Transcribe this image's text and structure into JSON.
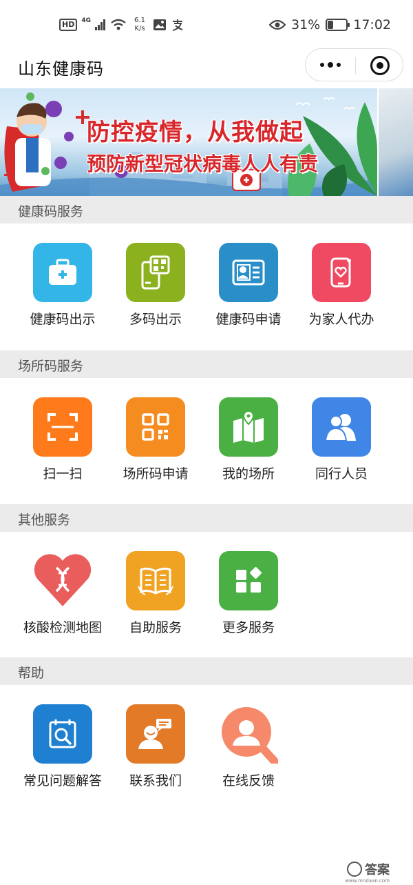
{
  "status_bar": {
    "hd": "HD",
    "network": "4G",
    "speed_value": "6.1",
    "speed_unit": "K/s",
    "battery_percent": "31%",
    "battery_level": 0.31,
    "time": "17:02"
  },
  "nav": {
    "title": "山东健康码"
  },
  "banner": {
    "line1": "防控疫情，从我做起",
    "line2": "预防新型冠状病毒人人有责"
  },
  "sections": [
    {
      "title": "健康码服务",
      "items": [
        {
          "label": "健康码出示",
          "icon": "medical-kit-icon",
          "color": "#33b5e8"
        },
        {
          "label": "多码出示",
          "icon": "phone-qr-icon",
          "color": "#8cb11f"
        },
        {
          "label": "健康码申请",
          "icon": "id-card-icon",
          "color": "#2a8fc8"
        },
        {
          "label": "为家人代办",
          "icon": "phone-heart-icon",
          "color": "#f04a63"
        }
      ]
    },
    {
      "title": "场所码服务",
      "items": [
        {
          "label": "扫一扫",
          "icon": "scan-icon",
          "color": "#ff7a1a"
        },
        {
          "label": "场所码申请",
          "icon": "qr-code-icon",
          "color": "#f58c1f"
        },
        {
          "label": "我的场所",
          "icon": "map-pin-icon",
          "color": "#4bb043"
        },
        {
          "label": "同行人员",
          "icon": "people-icon",
          "color": "#3f86e6"
        }
      ]
    },
    {
      "title": "其他服务",
      "items": [
        {
          "label": "核酸检测地图",
          "icon": "dna-heart-icon",
          "color": "#ea5d5d"
        },
        {
          "label": "自助服务",
          "icon": "book-icon",
          "color": "#f0a222"
        },
        {
          "label": "更多服务",
          "icon": "grid-icon",
          "color": "#4bb043"
        }
      ]
    },
    {
      "title": "帮助",
      "items": [
        {
          "label": "常见问题解答",
          "icon": "calendar-search-icon",
          "color": "#1f7fd0"
        },
        {
          "label": "联系我们",
          "icon": "contact-icon",
          "color": "#e27a28"
        },
        {
          "label": "在线反馈",
          "icon": "user-search-icon",
          "color": "#f5896a"
        }
      ]
    }
  ],
  "watermark": {
    "text": "答案",
    "sub": "www.mndaan.com"
  }
}
